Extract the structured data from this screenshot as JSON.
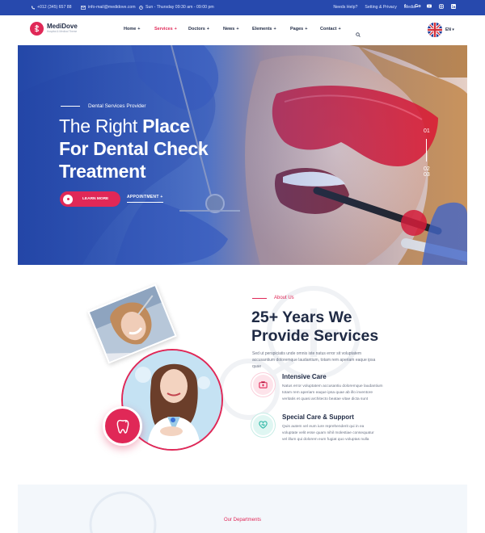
{
  "topbar": {
    "phone": "+012 (345) 657 88",
    "email": "info-mail@medidove.com",
    "hours": "Sun - Thursday 09:30 am - 09:00 pm",
    "links": [
      "Needs Help?",
      "Setting & Privacy",
      "Media"
    ],
    "socials": [
      "f",
      "Go",
      "yt",
      "in",
      "li"
    ]
  },
  "brand": {
    "name": "MediDove",
    "tagline": "Hospital & Medical Theme"
  },
  "menu": [
    {
      "label": "Home",
      "active": false
    },
    {
      "label": "Services",
      "active": true
    },
    {
      "label": "Doctors",
      "active": false
    },
    {
      "label": "News",
      "active": false
    },
    {
      "label": "Elements",
      "active": false
    },
    {
      "label": "Pages",
      "active": false
    },
    {
      "label": "Contact",
      "active": false
    }
  ],
  "menu_plus": "+",
  "language": "EN",
  "hero": {
    "label": "Dental Services Provider",
    "title_thin": "The Right",
    "title_bold_1": "Place",
    "title_line2": "For Dental Check",
    "title_line3": "Treatment",
    "btn_more": "LEARN MORE",
    "btn_appt": "APPOINTMENT",
    "slides": [
      "01",
      "02",
      "03"
    ]
  },
  "about": {
    "subtitle": "About Us",
    "title_line1": "25+ Years We",
    "title_line2": "Provide Services",
    "text": "Sed ut perspiciatis unde omnis iste natus error sit voluptatem accusantium doloremque laudantium, totam rem aperiam eaque ipsa quae",
    "features": [
      {
        "title": "Intensive Care",
        "text": "Natus error voluptatem accusantiu doloremque laudantium totam rem aperiam eaque ipsa quae ab illo inventore veritatis et quasi architecto beatae vitae dicta sunt"
      },
      {
        "title": "Special Care & Support",
        "text": "Quis autem vel eum iure reprehenderit qui in ea voluptate velit esse quam nihil molestiae consequatur vel illum qui dolorem eum fugiat quo voluptas nulla"
      }
    ]
  },
  "departments": {
    "subtitle": "Our Departments"
  },
  "colors": {
    "primary": "#e02857",
    "navy": "#2749ad",
    "dark": "#1f2a44",
    "teal": "#2bb6a4"
  }
}
